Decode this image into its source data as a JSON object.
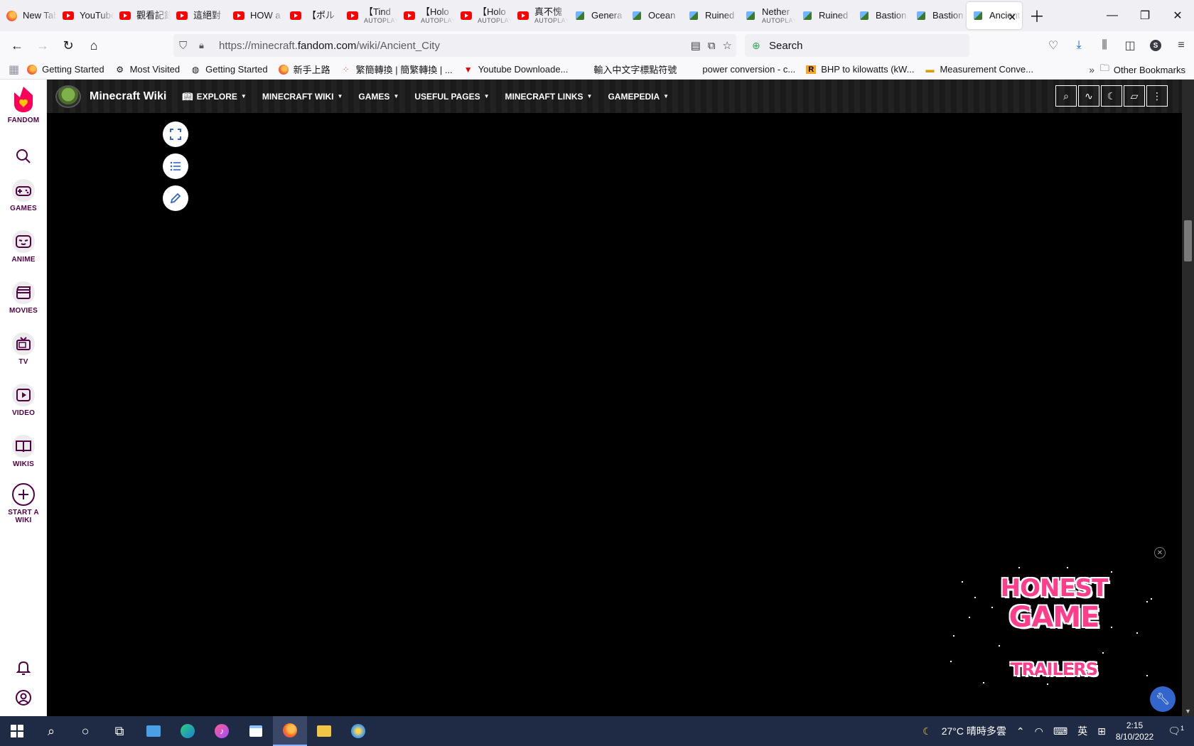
{
  "tabs": [
    {
      "title": "New Tab",
      "sub": "",
      "icon": "firefox"
    },
    {
      "title": "YouTube",
      "sub": "",
      "icon": "youtube"
    },
    {
      "title": "觀看記錄",
      "sub": "",
      "icon": "youtube"
    },
    {
      "title": "這絕對",
      "sub": "",
      "icon": "youtube"
    },
    {
      "title": "HOW a",
      "sub": "",
      "icon": "youtube"
    },
    {
      "title": "【ポル",
      "sub": "",
      "icon": "youtube"
    },
    {
      "title": "【Tind",
      "sub": "AUTOPLAY",
      "icon": "youtube"
    },
    {
      "title": "【Holo",
      "sub": "AUTOPLAY",
      "icon": "youtube"
    },
    {
      "title": "【Holo",
      "sub": "AUTOPLAY",
      "icon": "youtube"
    },
    {
      "title": "真不愧",
      "sub": "AUTOPLAY",
      "icon": "youtube"
    },
    {
      "title": "Genera",
      "sub": "",
      "icon": "minecraft"
    },
    {
      "title": "Ocean",
      "sub": "",
      "icon": "minecraft"
    },
    {
      "title": "Ruined",
      "sub": "",
      "icon": "minecraft"
    },
    {
      "title": "Nether",
      "sub": "AUTOPLAY",
      "icon": "minecraft"
    },
    {
      "title": "Ruined",
      "sub": "",
      "icon": "minecraft"
    },
    {
      "title": "Bastion",
      "sub": "",
      "icon": "minecraft"
    },
    {
      "title": "Bastion",
      "sub": "",
      "icon": "minecraft"
    },
    {
      "title": "Ancient",
      "sub": "",
      "icon": "minecraft",
      "active": true
    }
  ],
  "urlbar": {
    "prefix": "https://minecraft.",
    "domain": "fandom.com",
    "path": "/wiki/Ancient_City"
  },
  "search": {
    "placeholder": "Search"
  },
  "profile_initial": "S",
  "bookmarks": [
    {
      "label": "Getting Started",
      "icon": "firefox-icon"
    },
    {
      "label": "Most Visited",
      "icon": "gear-icon"
    },
    {
      "label": "Getting Started",
      "icon": "globe-icon"
    },
    {
      "label": "新手上路",
      "icon": "firefox-icon"
    },
    {
      "label": "繁簡轉換 | 簡繁轉換 | ...",
      "icon": "dots-icon"
    },
    {
      "label": "Youtube Downloade...",
      "icon": "download-icon"
    },
    {
      "label": "輸入中文字標點符號",
      "icon": "blank-icon"
    },
    {
      "label": "power conversion - c...",
      "icon": "blank-icon"
    },
    {
      "label": "BHP to kilowatts (kW...",
      "icon": "r-icon"
    },
    {
      "label": "Measurement Conve...",
      "icon": "ruler-icon"
    }
  ],
  "other_bookmarks": "Other Bookmarks",
  "fandom_nav": {
    "brand": "FANDOM",
    "items": [
      {
        "label": "GAMES"
      },
      {
        "label": "ANIME"
      },
      {
        "label": "MOVIES"
      },
      {
        "label": "TV"
      },
      {
        "label": "VIDEO"
      },
      {
        "label": "WIKIS"
      },
      {
        "label": "START A WIKI"
      }
    ]
  },
  "wiki": {
    "name": "Minecraft Wiki",
    "menu": [
      "EXPLORE",
      "MINECRAFT WIKI",
      "GAMES",
      "USEFUL PAGES",
      "MINECRAFT LINKS",
      "GAMEPEDIA"
    ]
  },
  "ad": {
    "line1": "HONEST",
    "line2": "GAME",
    "line3": "TRAILERS"
  },
  "taskbar": {
    "weather": "27°C  晴時多雲",
    "ime": "英",
    "time": "2:15",
    "date": "8/10/2022",
    "notifications": "1"
  },
  "colors": {
    "fandom_purple": "#520044",
    "fandom_pink": "#fa005a",
    "wiki_blue": "#3366cc",
    "ad_pink": "#ff3d8b"
  }
}
